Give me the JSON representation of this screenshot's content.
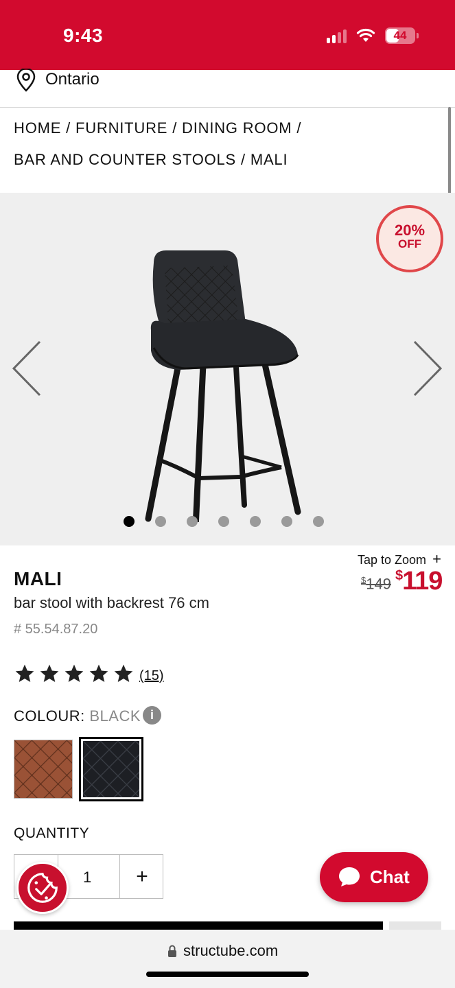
{
  "status_bar": {
    "time": "9:43",
    "battery": "44"
  },
  "location": {
    "label": "Ontario"
  },
  "breadcrumb": {
    "items": [
      "HOME",
      "FURNITURE",
      "DINING ROOM",
      "BAR AND COUNTER STOOLS",
      "MALI"
    ],
    "separator": "/"
  },
  "gallery": {
    "discount_percent": "20%",
    "discount_label": "OFF",
    "dots_total": 7,
    "dots_active": 1,
    "tap_to_zoom": "Tap to Zoom"
  },
  "product": {
    "name": "MALI",
    "description": "bar stool with backrest 76 cm",
    "sku": "# 55.54.87.20",
    "currency_symbol": "$",
    "price_old": "149",
    "price_new": "119",
    "rating": 5,
    "review_count": "(15)"
  },
  "colour": {
    "label": "COLOUR:",
    "value": "BLACK",
    "options": [
      {
        "name": "brown",
        "color": "#9a5236",
        "selected": false
      },
      {
        "name": "black",
        "color": "#1d1f24",
        "selected": true
      }
    ]
  },
  "quantity": {
    "label": "QUANTITY",
    "value": "1",
    "plus": "+"
  },
  "chat": {
    "label": "Chat"
  },
  "browser": {
    "url": "structube.com"
  },
  "colors": {
    "brand_red": "#d20a2e",
    "price_red": "#c8102e"
  }
}
